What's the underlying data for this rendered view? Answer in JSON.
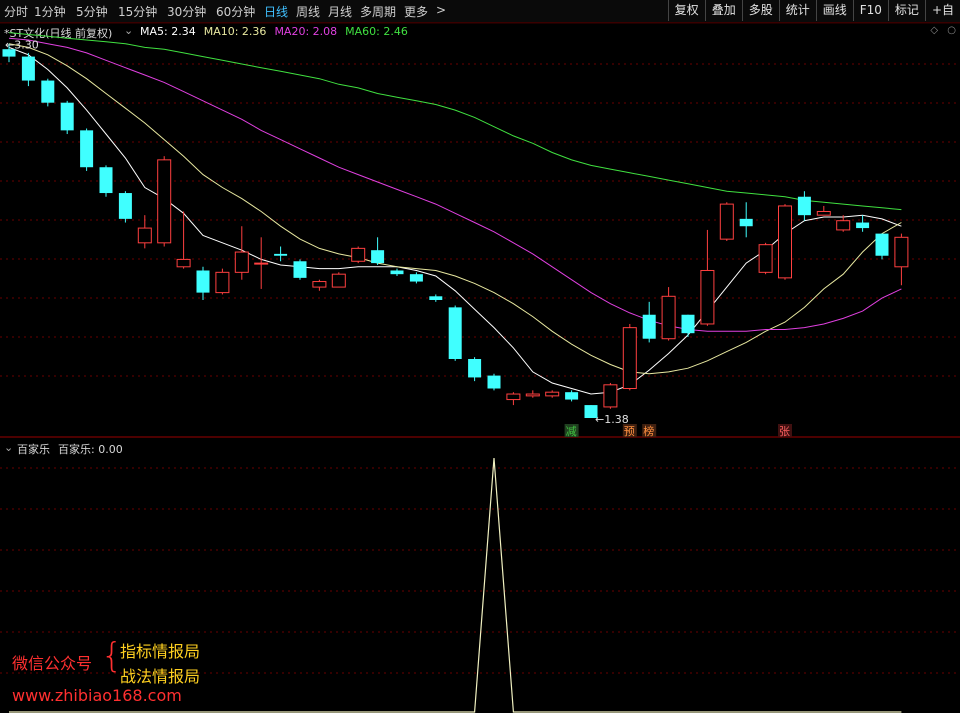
{
  "toolbar": {
    "periods": [
      {
        "label": "分时",
        "x": 4
      },
      {
        "label": "1分钟",
        "x": 34
      },
      {
        "label": "5分钟",
        "x": 76
      },
      {
        "label": "15分钟",
        "x": 118
      },
      {
        "label": "30分钟",
        "x": 167
      },
      {
        "label": "60分钟",
        "x": 216
      },
      {
        "label": "日线",
        "x": 264,
        "active": true
      },
      {
        "label": "周线",
        "x": 296
      },
      {
        "label": "月线",
        "x": 328
      },
      {
        "label": "多周期",
        "x": 360
      },
      {
        "label": "更多",
        "x": 404
      }
    ],
    "more_chevron": ">",
    "right_buttons": [
      "复权",
      "叠加",
      "多股",
      "统计",
      "画线",
      "F10",
      "标记",
      "+自"
    ]
  },
  "main_panel": {
    "stock_title": "*ST文化(日线 前复权)",
    "ma_legend": [
      {
        "label": "MA5: 2.34",
        "color": "#ffffff"
      },
      {
        "label": "MA10: 2.36",
        "color": "#e8e8a0"
      },
      {
        "label": "MA20: 2.08",
        "color": "#e040e0"
      },
      {
        "label": "MA60: 2.46",
        "color": "#40e040"
      }
    ],
    "high_label": "3.30",
    "low_label": "1.38",
    "signal_tags": [
      {
        "text": "减",
        "color": "#40c040",
        "bg": "#204020"
      },
      {
        "text": "预",
        "color": "#ff9040",
        "bg": "#402010"
      },
      {
        "text": "榜",
        "color": "#ff9040",
        "bg": "#402010"
      },
      {
        "text": "张",
        "color": "#ff6060",
        "bg": "#401010"
      }
    ]
  },
  "chart_data": {
    "type": "candlestick",
    "price_axis": [
      1.3,
      3.35
    ],
    "candles": [
      [
        3.3,
        3.26,
        3.33,
        3.23
      ],
      [
        3.26,
        3.13,
        3.28,
        3.1
      ],
      [
        3.13,
        3.01,
        3.14,
        2.99
      ],
      [
        3.01,
        2.86,
        3.02,
        2.84
      ],
      [
        2.86,
        2.66,
        2.87,
        2.64
      ],
      [
        2.66,
        2.52,
        2.67,
        2.5
      ],
      [
        2.52,
        2.38,
        2.53,
        2.36
      ],
      [
        2.25,
        2.33,
        2.4,
        2.22
      ],
      [
        2.25,
        2.7,
        2.72,
        2.23
      ],
      [
        2.12,
        2.16,
        2.42,
        2.11
      ],
      [
        2.1,
        1.98,
        2.12,
        1.94
      ],
      [
        1.98,
        2.09,
        2.11,
        1.97
      ],
      [
        2.09,
        2.2,
        2.34,
        2.05
      ],
      [
        2.14,
        2.14,
        2.28,
        2.0
      ],
      [
        2.19,
        2.18,
        2.23,
        2.15
      ],
      [
        2.15,
        2.06,
        2.16,
        2.05
      ],
      [
        2.01,
        2.04,
        2.05,
        1.99
      ],
      [
        2.01,
        2.08,
        2.09,
        2.01
      ],
      [
        2.15,
        2.22,
        2.23,
        2.14
      ],
      [
        2.21,
        2.14,
        2.28,
        2.13
      ],
      [
        2.1,
        2.08,
        2.11,
        2.07
      ],
      [
        2.08,
        2.04,
        2.09,
        2.03
      ],
      [
        1.96,
        1.94,
        1.97,
        1.93
      ],
      [
        1.9,
        1.62,
        1.91,
        1.61
      ],
      [
        1.62,
        1.52,
        1.63,
        1.5
      ],
      [
        1.53,
        1.46,
        1.54,
        1.45
      ],
      [
        1.4,
        1.43,
        1.44,
        1.37
      ],
      [
        1.42,
        1.43,
        1.45,
        1.41
      ],
      [
        1.42,
        1.44,
        1.45,
        1.41
      ],
      [
        1.44,
        1.4,
        1.45,
        1.39
      ],
      [
        1.37,
        1.3,
        1.37,
        1.3
      ],
      [
        1.36,
        1.48,
        1.49,
        1.35
      ],
      [
        1.46,
        1.79,
        1.81,
        1.45
      ],
      [
        1.86,
        1.73,
        1.93,
        1.71
      ],
      [
        1.73,
        1.96,
        2.01,
        1.72
      ],
      [
        1.86,
        1.76,
        1.86,
        1.74
      ],
      [
        1.81,
        2.1,
        2.32,
        1.8
      ],
      [
        2.27,
        2.46,
        2.47,
        2.26
      ],
      [
        2.38,
        2.34,
        2.47,
        2.28
      ],
      [
        2.09,
        2.24,
        2.25,
        2.08
      ],
      [
        2.06,
        2.45,
        2.46,
        2.05
      ],
      [
        2.5,
        2.4,
        2.53,
        2.37
      ],
      [
        2.4,
        2.42,
        2.45,
        2.4
      ],
      [
        2.32,
        2.37,
        2.4,
        2.31
      ],
      [
        2.36,
        2.33,
        2.4,
        2.31
      ],
      [
        2.3,
        2.18,
        2.3,
        2.16
      ],
      [
        2.12,
        2.28,
        2.3,
        2.02
      ]
    ],
    "series": [
      {
        "name": "MA5",
        "color": "#ffffff",
        "values": [
          3.31,
          3.27,
          3.19,
          3.09,
          2.97,
          2.84,
          2.71,
          2.55,
          2.49,
          2.41,
          2.29,
          2.25,
          2.21,
          2.16,
          2.13,
          2.12,
          2.11,
          2.11,
          2.12,
          2.12,
          2.12,
          2.1,
          2.07,
          1.99,
          1.89,
          1.79,
          1.68,
          1.55,
          1.49,
          1.46,
          1.43,
          1.44,
          1.48,
          1.56,
          1.65,
          1.75,
          1.88,
          2.01,
          2.14,
          2.21,
          2.3,
          2.37,
          2.39,
          2.39,
          2.4,
          2.38,
          2.34
        ]
      },
      {
        "name": "MA10",
        "color": "#e8e8a0",
        "values": [
          3.33,
          3.31,
          3.27,
          3.21,
          3.14,
          3.06,
          2.98,
          2.9,
          2.81,
          2.72,
          2.62,
          2.55,
          2.49,
          2.42,
          2.34,
          2.27,
          2.22,
          2.19,
          2.17,
          2.14,
          2.12,
          2.11,
          2.1,
          2.07,
          2.03,
          1.98,
          1.92,
          1.85,
          1.77,
          1.7,
          1.64,
          1.59,
          1.55,
          1.54,
          1.55,
          1.57,
          1.61,
          1.66,
          1.71,
          1.77,
          1.82,
          1.9,
          2.0,
          2.08,
          2.2,
          2.3,
          2.36
        ]
      },
      {
        "name": "MA20",
        "color": "#e040e0",
        "values": [
          3.36,
          3.35,
          3.33,
          3.31,
          3.28,
          3.24,
          3.2,
          3.16,
          3.12,
          3.07,
          3.02,
          2.97,
          2.92,
          2.86,
          2.81,
          2.76,
          2.71,
          2.66,
          2.62,
          2.58,
          2.54,
          2.5,
          2.46,
          2.41,
          2.36,
          2.31,
          2.25,
          2.19,
          2.12,
          2.05,
          1.98,
          1.92,
          1.87,
          1.83,
          1.8,
          1.78,
          1.77,
          1.77,
          1.77,
          1.78,
          1.78,
          1.79,
          1.81,
          1.84,
          1.88,
          1.95,
          2.0
        ]
      },
      {
        "name": "MA60",
        "color": "#40e040",
        "values": [
          3.39,
          3.38,
          3.37,
          3.36,
          3.35,
          3.34,
          3.33,
          3.31,
          3.3,
          3.28,
          3.26,
          3.24,
          3.22,
          3.2,
          3.18,
          3.16,
          3.14,
          3.11,
          3.09,
          3.06,
          3.04,
          3.02,
          3.0,
          2.97,
          2.93,
          2.88,
          2.83,
          2.79,
          2.74,
          2.7,
          2.67,
          2.65,
          2.63,
          2.61,
          2.59,
          2.57,
          2.55,
          2.53,
          2.52,
          2.51,
          2.5,
          2.48,
          2.47,
          2.46,
          2.45,
          2.44,
          2.43
        ]
      }
    ]
  },
  "indicator_panel": {
    "title": "百家乐",
    "value_label": "百家乐: 0.00",
    "values": [
      0,
      0,
      0,
      0,
      0,
      0,
      0,
      0,
      0,
      0,
      0,
      0,
      0,
      0,
      0,
      0,
      0,
      0,
      0,
      0,
      0,
      0,
      0,
      0,
      0,
      1,
      0,
      0,
      0,
      0,
      0,
      0,
      0,
      0,
      0,
      0,
      0,
      0,
      0,
      0,
      0,
      0,
      0,
      0,
      0,
      0,
      0
    ]
  },
  "watermark": {
    "label": "微信公众号",
    "line1": "指标情报局",
    "line2": "战法情报局",
    "url": "www.zhibiao168.com"
  },
  "colors": {
    "up": "#ff4040",
    "down": "#40ffff",
    "grid": "#6a0000",
    "panel_border": "#9a0000"
  }
}
